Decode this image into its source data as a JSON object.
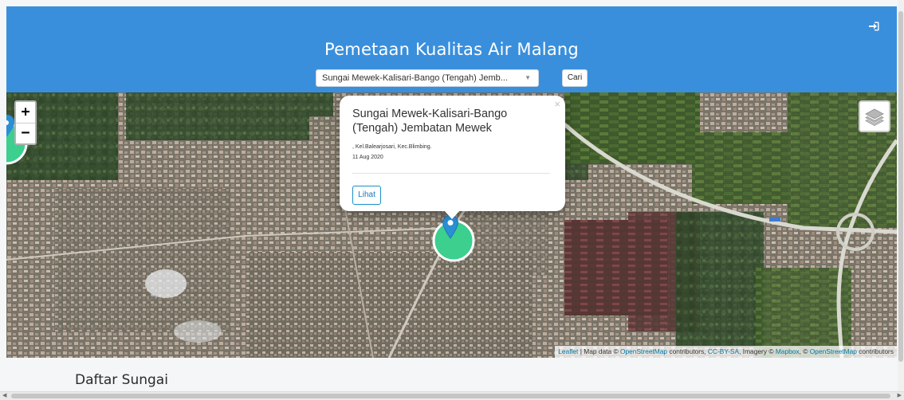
{
  "header": {
    "title": "Pemetaan Kualitas Air Malang",
    "login_icon": "sign-in-icon",
    "background": "#3a8fdc"
  },
  "search": {
    "selected_option": "Sungai Mewek-Kalisari-Bango (Tengah) Jemb...",
    "dropdown_arrow": "▼",
    "button_label": "Cari"
  },
  "map": {
    "zoom_in_label": "+",
    "zoom_out_label": "−",
    "layers_icon": "layers-icon",
    "marker_color": "#2a8fd4",
    "circle_color": "#3ccf8e",
    "attribution": {
      "leaflet": "Leaflet",
      "sep1": " | Map data © ",
      "osm1": "OpenStreetMap",
      "contrib1": " contributors, ",
      "ccbysa": "CC-BY-SA",
      "imagery": ", Imagery © ",
      "mapbox": "Mapbox",
      "sep2": ", © ",
      "osm2": "OpenStreetMap",
      "contrib2": " contributors"
    }
  },
  "popup": {
    "title": "Sungai Mewek-Kalisari-Bango (Tengah) Jembatan Mewek",
    "address": ", Kel.Balearjosari, Kec.Blimbing.",
    "date": "11 Aug 2020",
    "close_label": "×",
    "button_label": "Lihat"
  },
  "section": {
    "title": "Daftar Sungai"
  },
  "scrollbar": {
    "left_arrow": "◀",
    "right_arrow": "▶"
  }
}
